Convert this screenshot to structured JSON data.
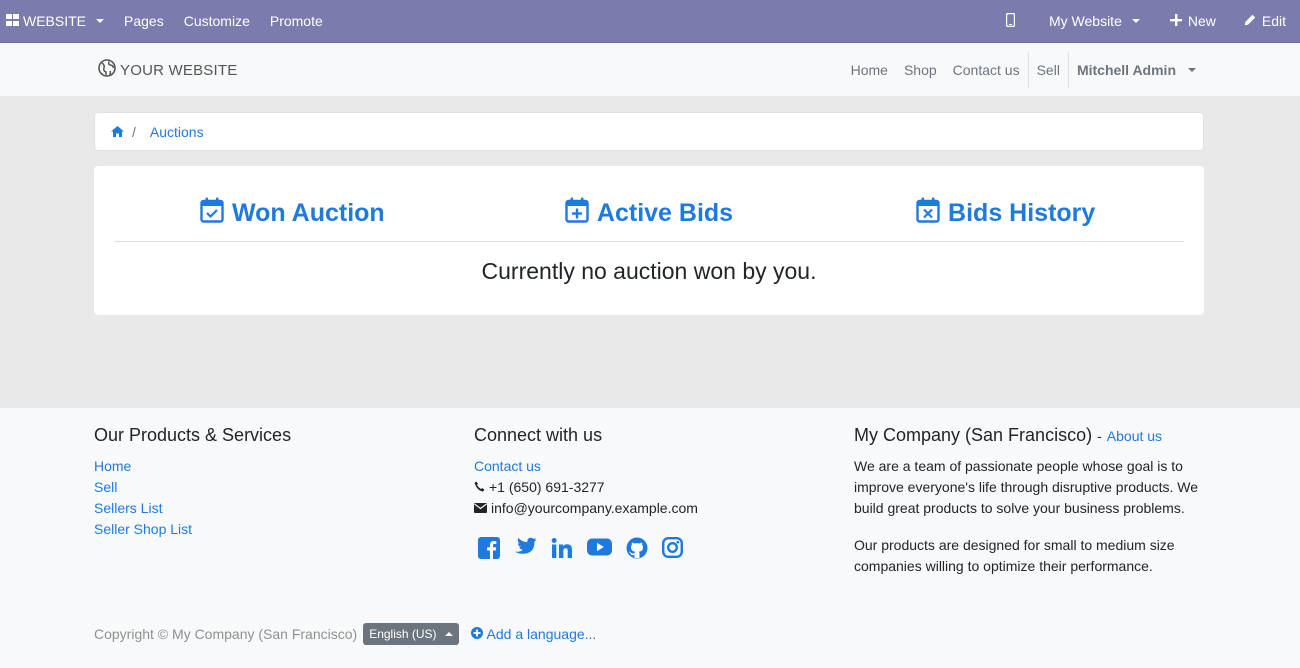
{
  "adminbar": {
    "website_label": "WEBSITE",
    "menu": [
      "Pages",
      "Customize",
      "Promote"
    ],
    "my_website": "My Website",
    "new_label": "New",
    "edit_label": "Edit"
  },
  "header": {
    "logo": "YOUR WEBSITE",
    "nav": [
      "Home",
      "Shop",
      "Contact us",
      "Sell"
    ],
    "user": "Mitchell Admin"
  },
  "breadcrumb": {
    "separator": "/",
    "current": "Auctions"
  },
  "auction": {
    "tabs": [
      "Won Auction",
      "Active Bids",
      "Bids History"
    ],
    "empty_message": "Currently no auction won by you."
  },
  "footer": {
    "products": {
      "title": "Our Products & Services",
      "links": [
        "Home",
        "Sell",
        "Sellers List",
        "Seller Shop List"
      ]
    },
    "connect": {
      "title": "Connect with us",
      "contact_link": "Contact us",
      "phone": "+1 (650) 691-3277",
      "email": "info@yourcompany.example.com",
      "socials": [
        "facebook-icon",
        "twitter-icon",
        "linkedin-icon",
        "youtube-icon",
        "github-icon",
        "instagram-icon"
      ]
    },
    "company": {
      "title": "My Company (San Francisco)",
      "dash": "-",
      "about_link": "About us",
      "paragraph1": "We are a team of passionate people whose goal is to improve everyone's life through disruptive products. We build great products to solve your business problems.",
      "paragraph2": "Our products are designed for small to medium size companies willing to optimize their performance."
    },
    "copyright": "Copyright © My Company (San Francisco)",
    "language": "English (US)",
    "add_language": "Add a language..."
  },
  "colors": {
    "adminbar": "#7c7bad",
    "link": "#1f7ae0"
  }
}
